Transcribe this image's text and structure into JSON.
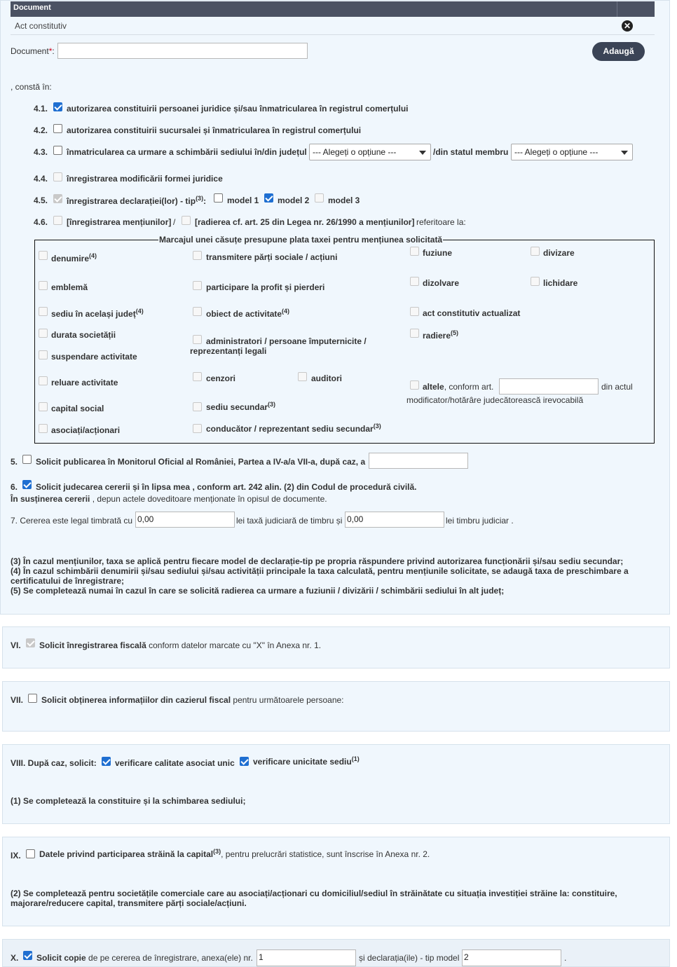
{
  "document": {
    "header": "Document",
    "row_value": "Act constitutiv",
    "field_label": "Document",
    "field_required_mark": "*",
    "field_colon": ":",
    "field_value": "",
    "add_button": "Adaugă"
  },
  "consta_in": ", constă în:",
  "items": {
    "i41": {
      "num": "4.1.",
      "label": "autorizarea constituirii persoanei juridice și/sau înmatricularea în registrul comerțului"
    },
    "i42": {
      "num": "4.2.",
      "label": "autorizarea constituirii sucursalei și înmatricularea în registrul comerțului"
    },
    "i43": {
      "num": "4.3.",
      "label": "înmatricularea ca urmare a schimbării sediului în/din județul",
      "select1": "--- Alegeți o opțiune ---",
      "mid": "/din statul membru",
      "select2": "--- Alegeți o opțiune ---"
    },
    "i44": {
      "num": "4.4.",
      "label": "înregistrarea modificării formei juridice"
    },
    "i45": {
      "num": "4.5.",
      "label": "înregistrarea declarației(lor) - tip",
      "sup": "(3)",
      "colon": ":",
      "m1": "model 1",
      "m2": "model 2",
      "m3": "model 3"
    },
    "i46": {
      "num": "4.6.",
      "label_a": "[înregistrarea mențiunilor]",
      "slash": "/",
      "label_b": "[radierea cf. art. 25 din Legea nr. 26/1990 a mențiunilor]",
      "tail": "referitoare la:"
    }
  },
  "fieldset": {
    "legend": "Marcajul unei căsuțe presupune plata taxei pentru mențiunea solicitată",
    "denumire": "denumire",
    "denumire_sup": "(4)",
    "transmitere": "transmitere părți sociale / acțiuni",
    "fuziune": "fuziune",
    "divizare": "divizare",
    "emblema": "emblemă",
    "participare": "participare la profit și pierderi",
    "dizolvare": "dizolvare",
    "lichidare": "lichidare",
    "sediu_judet": "sediu în același județ",
    "sediu_judet_sup": "(4)",
    "obiect": "obiect de activitate",
    "obiect_sup": "(4)",
    "act_actualizat": "act constitutiv actualizat",
    "durata": "durata societății",
    "administratori_1": "administratori / persoane împuternicite /",
    "administratori_2": "reprezentanți legali",
    "radiere": "radiere",
    "radiere_sup": "(5)",
    "suspendare": "suspendare activitate",
    "reluare": "reluare activitate",
    "cenzori": "cenzori",
    "auditori": "auditori",
    "altele": "altele",
    "altele_conform": ", conform art.",
    "altele_value": "",
    "din_actul": "din actul",
    "modificator": "modificator/hotărâre judecătorească irevocabilă",
    "capital": "capital social",
    "sediu_secundar": "sediu secundar",
    "sediu_secundar_sup": "(3)",
    "asociati": "asociați/acționari",
    "conducator": "conducător / reprezentant sediu secundar",
    "conducator_sup": "(3)"
  },
  "p5": {
    "num": "5.",
    "label": "Solicit publicarea în Monitorul Oficial al României, Partea a IV-a/a VII-a, după caz, a",
    "value": ""
  },
  "p6": {
    "num": "6.",
    "label": "Solicit judecarea cererii și în lipsa mea , conform art. 242 alin. (2) din Codul de procedură civilă.",
    "line2_bold": "În susținerea cererii",
    "line2_rest": ", depun actele doveditoare menționate în opisul de documente."
  },
  "p7": {
    "label": "7. Cererea este legal timbrată cu",
    "value1": "0,00",
    "mid": "lei taxă judiciară de timbru și",
    "value2": "0,00",
    "end": "lei timbru judiciar ."
  },
  "notes": {
    "n3": "(3) În cazul mențiunilor, taxa se aplică pentru fiecare model de declarație-tip pe propria răspundere privind autorizarea funcționării și/sau sediu secundar;",
    "n4a": "(4) În cazul schimbării denumirii și/sau sediului și/sau activității principale la taxa calculată, pentru mențiunile solicitate, se adaugă taxa de preschimbare a",
    "n4b": "certificatului de înregistrare;",
    "n5": "(5) Se completează numai în cazul în care se solicită radierea ca urmare a fuziunii / divizării / schimbării sediului în alt județ;"
  },
  "s6": {
    "num": "VI.",
    "bold": "Solicit înregistrarea fiscală",
    "rest": "conform datelor marcate cu \"X\" în Anexa nr. 1."
  },
  "s7": {
    "num": "VII.",
    "bold": "Solicit obținerea informațiilor din cazierul fiscal",
    "rest": "pentru următoarele persoane:"
  },
  "s8": {
    "label": "VIII. După caz, solicit:",
    "opt1": "verificare calitate asociat unic",
    "opt2": "verificare unicitate sediu",
    "opt2_sup": "(1)",
    "note": "(1) Se completează la constituire și la schimbarea sediului;"
  },
  "s9": {
    "num": "IX.",
    "bold": "Datele privind participarea străină la capital",
    "sup": "(3)",
    "rest": ", pentru prelucrări statistice, sunt înscrise în Anexa nr. 2.",
    "note_a": "(2) Se completează pentru societățile comerciale care au asociați/acționari cu domiciliul/sediul în străinătate cu situația investiției străine la: constituire,",
    "note_b": "majorare/reducere capital, transmitere părți sociale/acțiuni."
  },
  "s10": {
    "num": "X.",
    "bold": "Solicit copie",
    "rest": "de pe cererea de înregistrare, anexa(ele) nr.",
    "value1": "1",
    "mid": "și declarația(ile) - tip model",
    "value2": "2",
    "end": "."
  },
  "colors": {
    "panel": "#f0f7fd",
    "header": "#4b5263",
    "checkbox": "#1f6fd1",
    "button": "#3b4456"
  }
}
